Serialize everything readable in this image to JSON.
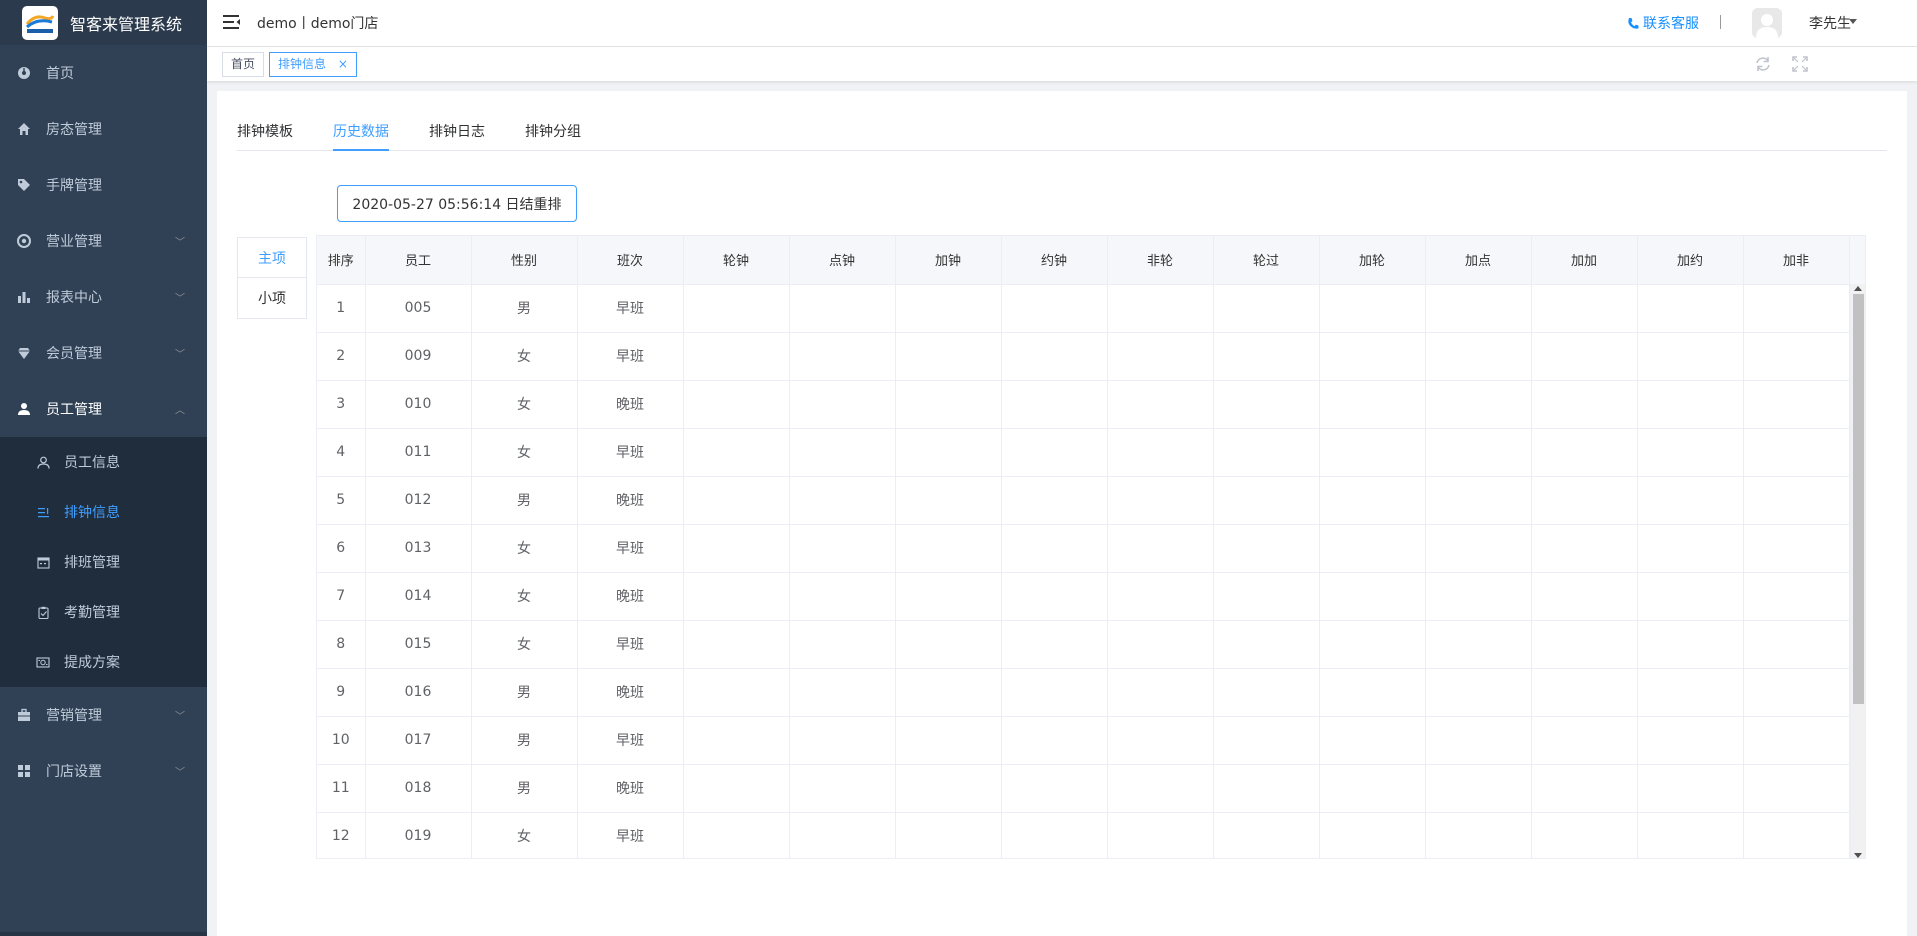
{
  "app": {
    "title": "智客来管理系统"
  },
  "sidebar": {
    "items": [
      {
        "label": "首页",
        "icon": "dashboard-icon"
      },
      {
        "label": "房态管理",
        "icon": "home-icon"
      },
      {
        "label": "手牌管理",
        "icon": "tag-icon"
      },
      {
        "label": "营业管理",
        "icon": "aperture-icon"
      },
      {
        "label": "报表中心",
        "icon": "chart-icon"
      },
      {
        "label": "会员管理",
        "icon": "diamond-icon"
      },
      {
        "label": "员工管理",
        "icon": "user-icon"
      },
      {
        "label": "营销管理",
        "icon": "briefcase-icon"
      },
      {
        "label": "门店设置",
        "icon": "grid-icon"
      }
    ],
    "subitems": [
      {
        "label": "员工信息",
        "icon": "user-outline-icon"
      },
      {
        "label": "排钟信息",
        "icon": "list-icon"
      },
      {
        "label": "排班管理",
        "icon": "calendar-icon"
      },
      {
        "label": "考勤管理",
        "icon": "clipboard-icon"
      },
      {
        "label": "提成方案",
        "icon": "money-icon"
      }
    ]
  },
  "header": {
    "store": "demo丨demo门店",
    "contact": "联系客服",
    "username": "李先生"
  },
  "tags": {
    "home": "首页",
    "current": "排钟信息",
    "close": "×"
  },
  "tabs": [
    "排钟模板",
    "历史数据",
    "排钟日志",
    "排钟分组"
  ],
  "date_badge": "2020-05-27 05:56:14 日结重排",
  "side_tabs": [
    "主项",
    "小项"
  ],
  "table": {
    "columns": [
      "排序",
      "员工",
      "性别",
      "班次",
      "轮钟",
      "点钟",
      "加钟",
      "约钟",
      "非轮",
      "轮过",
      "加轮",
      "加点",
      "加加",
      "加约",
      "加非"
    ],
    "rows": [
      [
        "1",
        "005",
        "男",
        "早班"
      ],
      [
        "2",
        "009",
        "女",
        "早班"
      ],
      [
        "3",
        "010",
        "女",
        "晚班"
      ],
      [
        "4",
        "011",
        "女",
        "早班"
      ],
      [
        "5",
        "012",
        "男",
        "晚班"
      ],
      [
        "6",
        "013",
        "女",
        "早班"
      ],
      [
        "7",
        "014",
        "女",
        "晚班"
      ],
      [
        "8",
        "015",
        "女",
        "早班"
      ],
      [
        "9",
        "016",
        "男",
        "晚班"
      ],
      [
        "10",
        "017",
        "男",
        "早班"
      ],
      [
        "11",
        "018",
        "男",
        "晚班"
      ],
      [
        "12",
        "019",
        "女",
        "早班"
      ]
    ]
  },
  "colors": {
    "sidebar_bg": "#304156",
    "submenu_bg": "#1f2d3d",
    "accent": "#409eff",
    "contact": "#1890ff"
  }
}
